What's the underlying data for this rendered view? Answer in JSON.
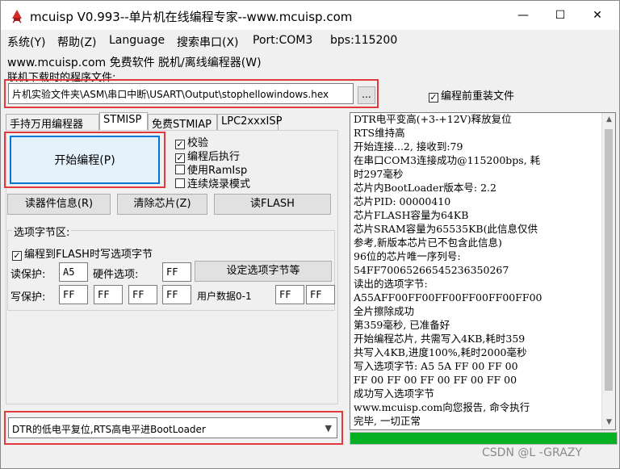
{
  "window": {
    "title": "mcuisp V0.993--单片机在线编程专家--www.mcuisp.com",
    "minimize": "—",
    "maximize": "☐",
    "close": "✕"
  },
  "menu": {
    "system": "系统(Y)",
    "help": "帮助(Z)",
    "language": "Language",
    "search_port": "搜索串口(X)",
    "port": "Port:COM3",
    "bps": "bps:115200"
  },
  "banner": "www.mcuisp.com 免费软件 脱机/离线编程器(W)",
  "file_label": "联机下载时的程序文件:",
  "file_path": "片机实验文件夹\\ASM\\串口中断\\USART\\Output\\stophellowindows.hex",
  "browse_label": "...",
  "reload_before_program": {
    "label": "编程前重装文件",
    "checked": true
  },
  "tabs": [
    "手持万用编程器",
    "STMISP",
    "免费STMIAP",
    "LPC2xxxISP"
  ],
  "start_button": "开始编程(P)",
  "options": [
    {
      "label": "校验",
      "checked": true
    },
    {
      "label": "编程后执行",
      "checked": true
    },
    {
      "label": "使用RamIsp",
      "checked": false
    },
    {
      "label": "连续烧录模式",
      "checked": false
    }
  ],
  "buttons": {
    "device_info": "读器件信息(R)",
    "clear_chip": "清除芯片(Z)",
    "read_flash": "读FLASH",
    "set_option_bytes": "设定选项字节等"
  },
  "option_bytes": {
    "group_title": "选项字节区:",
    "write_to_flash": {
      "label": "编程到FLASH时写选项字节",
      "checked": true
    },
    "read_protect_label": "读保护:",
    "read_protect_value": "A5",
    "hw_option_label": "硬件选项:",
    "hw_option_value": "FF",
    "write_protect_label": "写保护:",
    "write_protect_values": [
      "FF",
      "FF",
      "FF",
      "FF"
    ],
    "user_data_label": "用户数据0-1",
    "user_data_values": [
      "FF",
      "FF"
    ]
  },
  "boot_mode": "DTR的低电平复位,RTS高电平进BootLoader",
  "log_lines": [
    "DTR电平变高(+3-+12V)释放复位",
    "RTS维持高",
    "开始连接...2, 接收到:79",
    "在串口COM3连接成功@115200bps, 耗",
    "时297毫秒",
    "芯片内BootLoader版本号: 2.2",
    "芯片PID: 00000410",
    "芯片FLASH容量为64KB",
    "芯片SRAM容量为65535KB(此信息仅供",
    "参考,新版本芯片已不包含此信息)",
    "96位的芯片唯一序列号:",
    "54FF70065266545236350267",
    "读出的选项字节:",
    "A55AFF00FF00FF00FF00FF00FF00",
    "全片擦除成功",
    "第359毫秒, 已准备好",
    "开始编程芯片, 共需写入4KB,耗时359",
    "共写入4KB,进度100%,耗时2000毫秒",
    "写入选项字节: A5 5A FF 00 FF 00",
    "FF 00 FF 00 FF 00 FF 00 FF 00",
    "成功写入选项字节",
    "www.mcuisp.com向您报告, 命令执行",
    "完毕, 一切正常"
  ],
  "progress_percent": 100,
  "watermark": "CSDN @L -GRAZY",
  "colors": {
    "highlight_red": "#e0393e",
    "focus_blue": "#0078d7",
    "progress_green": "#06b025",
    "app_icon_red": "#d42a2a"
  }
}
